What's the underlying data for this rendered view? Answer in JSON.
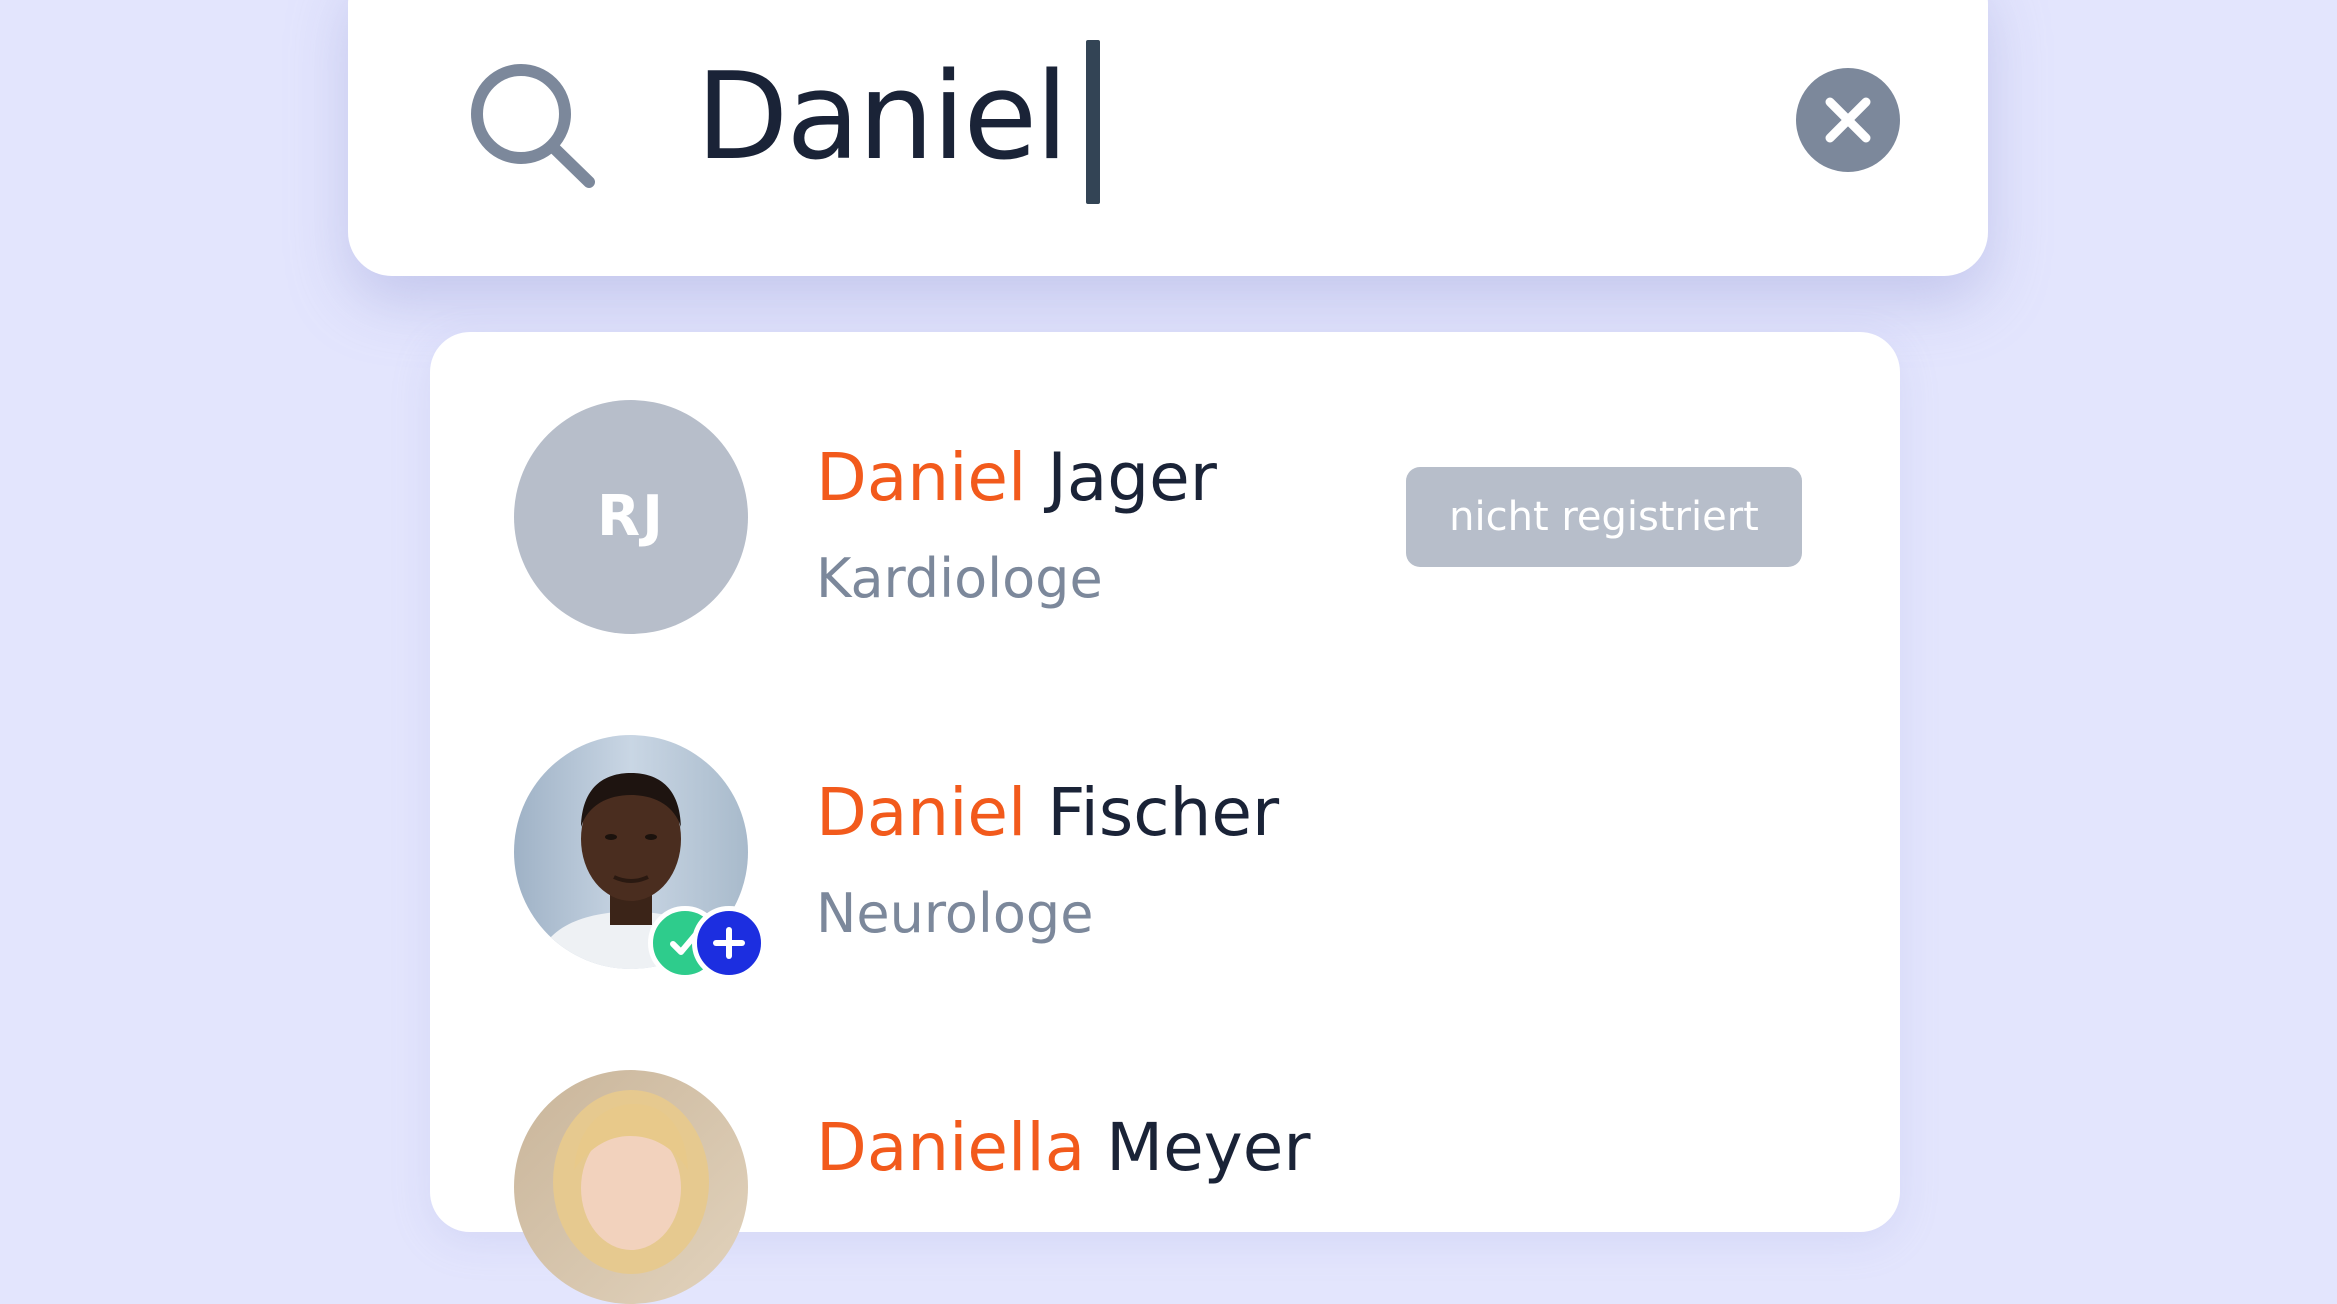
{
  "search": {
    "value": "Daniel"
  },
  "results": [
    {
      "initials": "RJ",
      "match": "Daniel",
      "rest": " Jager",
      "specialty": "Kardiologe",
      "badge": "nicht registriert"
    },
    {
      "match": "Daniel",
      "rest": " Fischer",
      "specialty": "Neurologe"
    },
    {
      "match": "Daniella",
      "rest": " Meyer"
    }
  ],
  "colors": {
    "background": "#e3e5fd",
    "highlight": "#f25a1c",
    "text": "#1a2337",
    "muted": "#7c889b",
    "badge": "#b7beca",
    "verified": "#2ecc8c",
    "add": "#1c2ee0"
  },
  "icons": [
    "search-icon",
    "close-icon",
    "check-icon",
    "plus-icon"
  ]
}
